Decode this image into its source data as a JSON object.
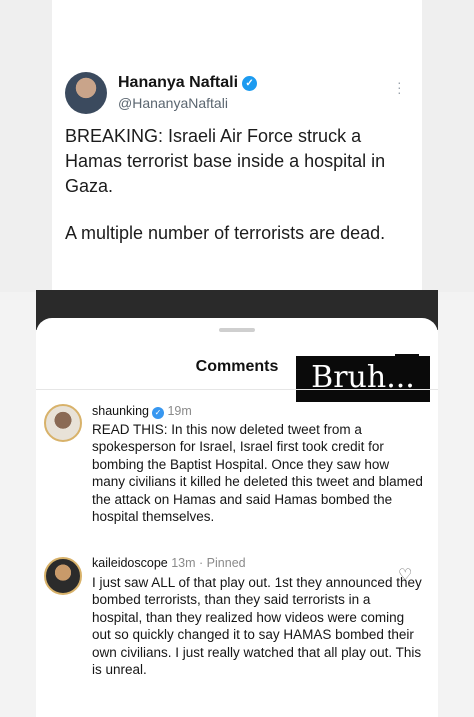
{
  "tweet": {
    "name": "Hananya Naftali",
    "verified_icon": "verified-badge-icon",
    "handle": "@HananyaNaftali",
    "more_icon": "⋮",
    "line1": "BREAKING: Israeli Air Force struck a Hamas terrorist base inside a hospital in Gaza.",
    "line2": "A multiple number of terrorists are dead."
  },
  "comments_panel": {
    "title": "Comments",
    "sticker_text": "Bruh...",
    "comments": [
      {
        "username": "shaunking",
        "time": "19m",
        "pinned": "",
        "text": "READ THIS: In this now deleted tweet from a spokesperson for Israel, Israel first took credit for bombing the Baptist Hospital. Once they saw how many civilians it killed he deleted this tweet and blamed the attack on Hamas and said Hamas bombed the hospital themselves."
      },
      {
        "username": "kaileidoscope",
        "time": "13m",
        "pinned": "Pinned",
        "text": "I just saw ALL of that play out. 1st they announced they bombed terrorists, than they said terrorists in a hospital, than they realized how videos were coming out so quickly changed it to say HAMAS bombed their own civilians. I just really watched that all play out. This is unreal."
      }
    ]
  },
  "colors": {
    "verified_blue": "#1d9bf0",
    "sticker_bg": "#0a0a0a",
    "avatar_ring": "#d8b26a"
  }
}
